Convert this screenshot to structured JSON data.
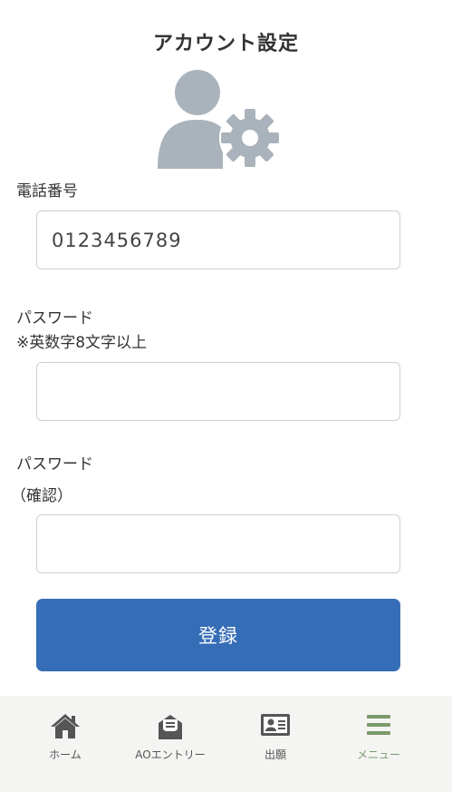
{
  "header": {
    "title": "アカウント設定"
  },
  "form": {
    "phone_label": "電話番号",
    "phone_value": "0123456789",
    "password_label": "パスワード",
    "password_hint": "※英数字8文字以上",
    "password_value": "",
    "confirm_label": "パスワード",
    "confirm_hint": "（確認）",
    "confirm_value": "",
    "submit_label": "登録"
  },
  "tabbar": {
    "items": [
      {
        "label": "ホーム",
        "icon": "home-icon"
      },
      {
        "label": "AOエントリー",
        "icon": "envelope-icon"
      },
      {
        "label": "出願",
        "icon": "id-card-icon"
      },
      {
        "label": "メニュー",
        "icon": "menu-icon",
        "active": true
      }
    ]
  },
  "colors": {
    "accent": "#366db7",
    "active_tab": "#7a9a6c",
    "icon_gray": "#aab3bb"
  }
}
